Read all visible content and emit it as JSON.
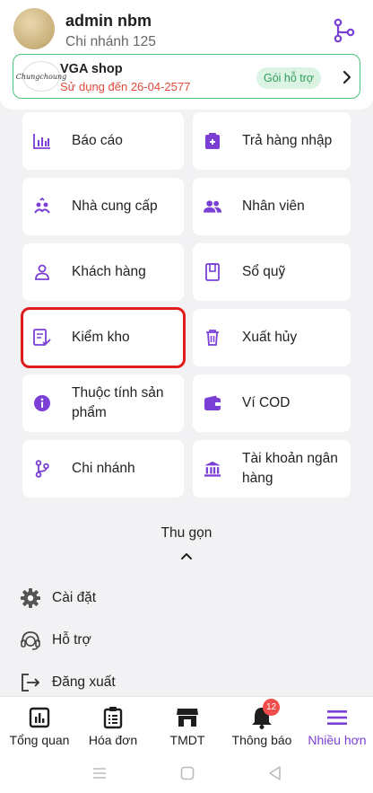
{
  "header": {
    "user_name": "admin nbm",
    "branch_name": "Chi nhánh 125"
  },
  "shop": {
    "logo_text": "Chungchoung",
    "name": "VGA shop",
    "expiry": "Sử dụng đến 26-04-2577",
    "plan_badge": "Gói hỗ trợ"
  },
  "menu": {
    "items": [
      {
        "label": "Báo cáo",
        "icon": "bar-chart-icon"
      },
      {
        "label": "Trả hàng nhập",
        "icon": "return-box-icon"
      },
      {
        "label": "Nhà cung cấp",
        "icon": "supplier-icon"
      },
      {
        "label": "Nhân viên",
        "icon": "staff-icon"
      },
      {
        "label": "Khách hàng",
        "icon": "customer-icon"
      },
      {
        "label": "Sổ quỹ",
        "icon": "cashbook-icon"
      },
      {
        "label": "Kiểm kho",
        "icon": "stock-check-icon",
        "highlighted": true
      },
      {
        "label": "Xuất hủy",
        "icon": "trash-icon"
      },
      {
        "label": "Thuộc tính sản phẩm",
        "icon": "info-icon"
      },
      {
        "label": "Ví COD",
        "icon": "wallet-icon"
      },
      {
        "label": "Chi nhánh",
        "icon": "branch-icon"
      },
      {
        "label": "Tài khoản ngân hàng",
        "icon": "bank-icon"
      }
    ],
    "collapse_label": "Thu gọn"
  },
  "settings": {
    "items": [
      {
        "label": "Cài đặt",
        "icon": "gear-icon"
      },
      {
        "label": "Hỗ trợ",
        "icon": "headset-icon"
      },
      {
        "label": "Đăng xuất",
        "icon": "logout-icon"
      }
    ]
  },
  "bottom_nav": {
    "items": [
      {
        "label": "Tổng quan",
        "icon": "overview-icon"
      },
      {
        "label": "Hóa đơn",
        "icon": "invoice-icon"
      },
      {
        "label": "TMDT",
        "icon": "store-icon"
      },
      {
        "label": "Thông báo",
        "icon": "bell-icon",
        "badge": "12"
      },
      {
        "label": "Nhiều hơn",
        "icon": "menu-icon",
        "active": true
      }
    ]
  },
  "colors": {
    "accent": "#7b3fd6",
    "highlight_border": "#e01c1c",
    "shop_border": "#4cc37a",
    "expiry_text": "#e24a3b",
    "badge_bg": "#f04c4c"
  }
}
